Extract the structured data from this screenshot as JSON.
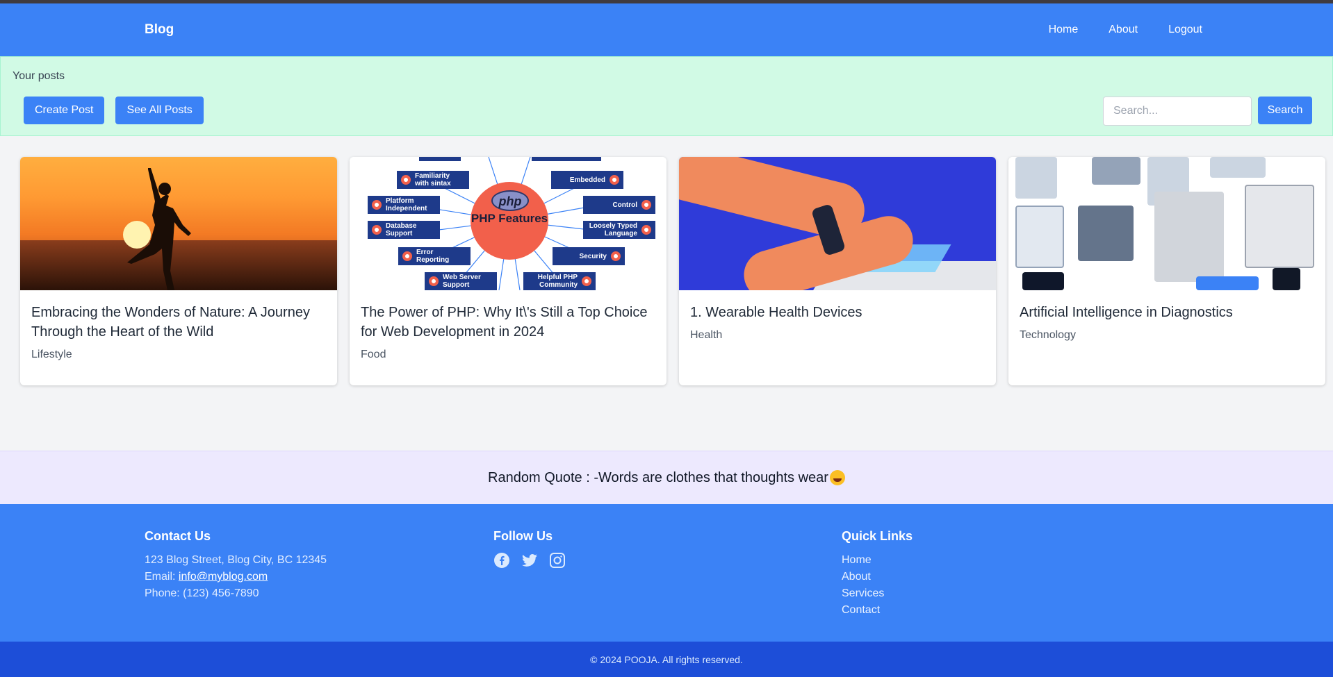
{
  "navbar": {
    "brand": "Blog",
    "links": [
      "Home",
      "About",
      "Logout"
    ]
  },
  "posts_bar": {
    "title": "Your posts",
    "create_label": "Create Post",
    "see_all_label": "See All Posts",
    "search_placeholder": "Search...",
    "search_label": "Search"
  },
  "posts": [
    {
      "title": "Embracing the Wonders of Nature: A Journey Through the Heart of the Wild",
      "category": "Lifestyle"
    },
    {
      "title": "The Power of PHP: Why It\\'s Still a Top Choice for Web Development in 2024",
      "category": "Food"
    },
    {
      "title": "1. Wearable Health Devices",
      "category": "Health"
    },
    {
      "title": "Artificial Intelligence in Diagnostics",
      "category": "Technology"
    }
  ],
  "php_image": {
    "logo": "php",
    "center": "PHP Features",
    "left_labels": [
      "Familiarity with sintax",
      "Platform Independent",
      "Database Support",
      "Error Reporting",
      "Web Server Support"
    ],
    "right_labels": [
      "Embedded",
      "Control",
      "Loosely Typed Language",
      "Security",
      "Helpful PHP Community"
    ]
  },
  "quote": {
    "text": "Random Quote : -Words are clothes that thoughts wear"
  },
  "footer": {
    "contact": {
      "heading": "Contact Us",
      "address": "123 Blog Street, Blog City, BC 12345",
      "email_label": "Email: ",
      "email": "info@myblog.com",
      "phone": "Phone: (123) 456-7890"
    },
    "follow": {
      "heading": "Follow Us",
      "icons": [
        "facebook-icon",
        "twitter-icon",
        "instagram-icon"
      ]
    },
    "quick_links": {
      "heading": "Quick Links",
      "links": [
        "Home",
        "About",
        "Services",
        "Contact"
      ]
    },
    "copyright": "© 2024 POOJA. All rights reserved."
  },
  "colors": {
    "primary": "#3b82f6",
    "posts_bar_bg": "#d1fae5",
    "quote_bg": "#ede9fe",
    "copyright_bg": "#1d4ed8"
  }
}
